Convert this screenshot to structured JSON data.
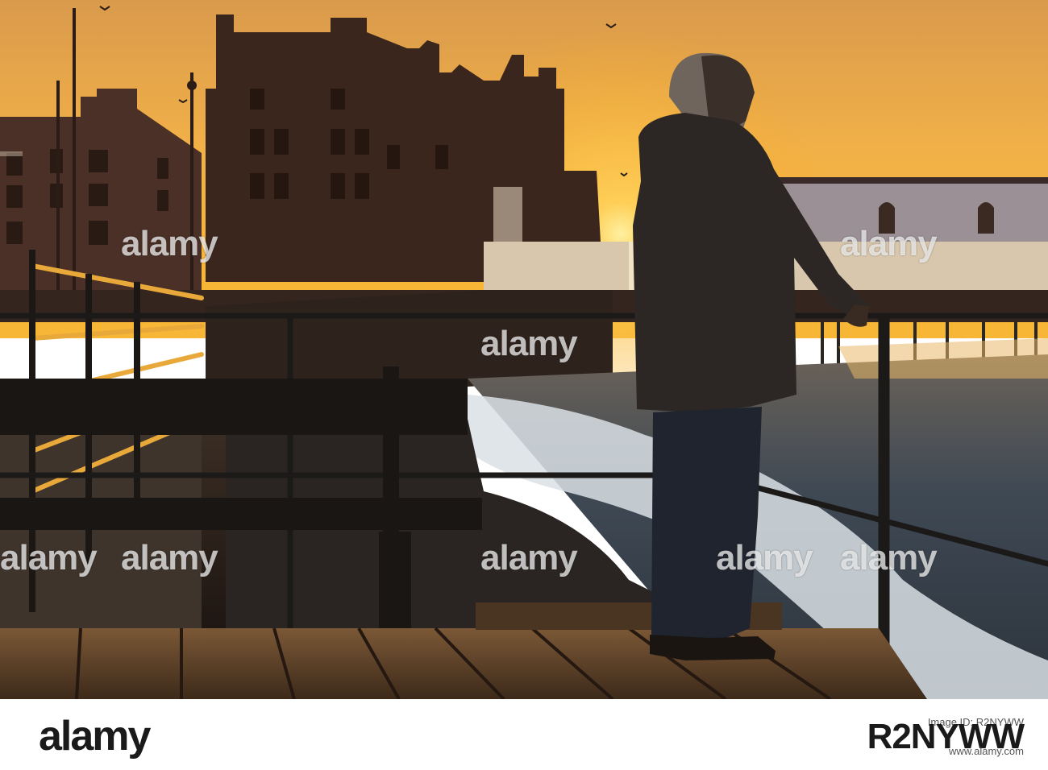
{
  "image": {
    "scene": "sunset seafront promenade silhouette with pier",
    "palette": {
      "sky_top": "#f0b04a",
      "sky_horizon": "#f7a91e",
      "sun": "#ffd768",
      "silhouette": "#2a1e18",
      "sea": "#4e5a66",
      "surf": "#dfe6ea",
      "deck": "#6b4a2e"
    }
  },
  "watermarks": [
    "alamy",
    "alamy",
    "alamy",
    "alamy",
    "alamy",
    "alamy",
    "alamy",
    "alamy"
  ],
  "footer": {
    "logo": "alamy",
    "image_id_line": "Image ID: R2NYWW",
    "site_line": "www.alamy.com",
    "code": "R2NYWW"
  }
}
